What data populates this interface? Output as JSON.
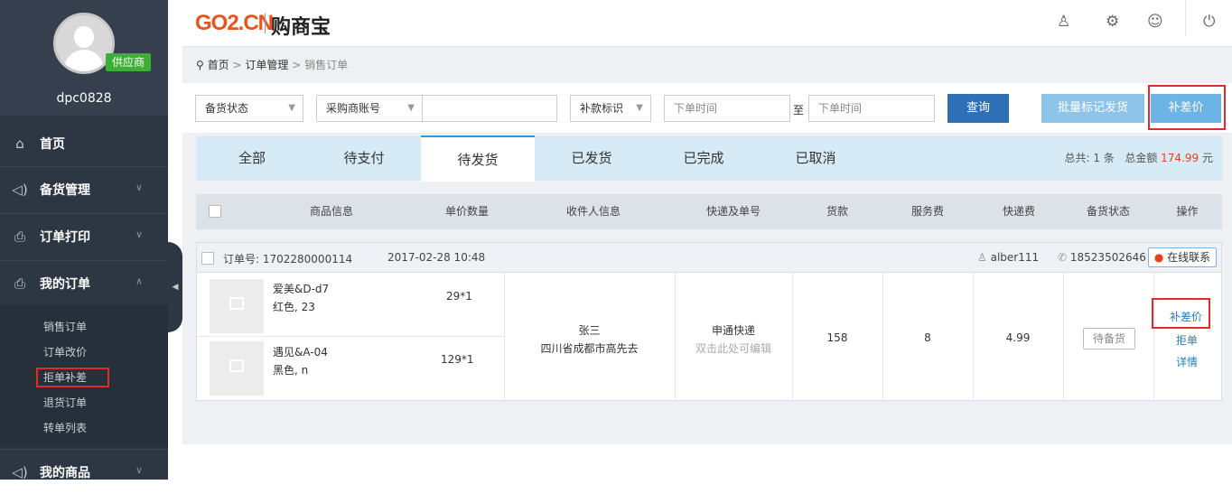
{
  "sidebar": {
    "role_badge": "供应商",
    "username": "dpc0828",
    "nav": [
      {
        "label": "首页",
        "icon": "home-icon"
      },
      {
        "label": "备货管理",
        "icon": "speaker-icon"
      },
      {
        "label": "订单打印",
        "icon": "printer-icon"
      },
      {
        "label": "我的订单",
        "icon": "printer-icon"
      },
      {
        "label": "我的商品",
        "icon": "speaker-icon"
      }
    ],
    "submenu": [
      "销售订单",
      "订单改价",
      "拒单补差",
      "退货订单",
      "转单列表"
    ]
  },
  "header": {
    "logo_text": "GO2.CN",
    "logo_cn": "购商宝"
  },
  "breadcrumb": {
    "home": "首页",
    "sep": ">",
    "level1": "订单管理",
    "level2": "销售订单"
  },
  "filters": {
    "stock_status": "备货状态",
    "buyer_account": "采购商账号",
    "buyer_account_value": "",
    "supplement_flag": "补款标识",
    "date_from_placeholder": "下单时间",
    "to_label": "至",
    "date_to_placeholder": "下单时间",
    "query_button": "查询",
    "batch_ship_button": "批量标记发货",
    "supplement_button": "补差价"
  },
  "tabs": [
    "全部",
    "待支付",
    "待发货",
    "已发货",
    "已完成",
    "已取消"
  ],
  "summary": {
    "prefix": "总共: 1 条",
    "amount_label": "总金额",
    "amount": "174.99",
    "unit": "元"
  },
  "columns": [
    "商品信息",
    "单价数量",
    "收件人信息",
    "快递及单号",
    "货款",
    "服务费",
    "快递费",
    "备货状态",
    "操作"
  ],
  "order": {
    "order_no": "订单号: 1702280000114",
    "time": "2017-02-28 10:48",
    "buyer": "alber111",
    "phone": "18523502646",
    "chat_button": "在线联系",
    "items": [
      {
        "name": "爱美&D-d7",
        "spec": "红色, 23",
        "qty": "29*1"
      },
      {
        "name": "遇见&A-04",
        "spec": "黑色, n",
        "qty": "129*1"
      }
    ],
    "recipient_name": "张三",
    "recipient_addr": "四川省成都市高先去",
    "express": "申通快递",
    "express_hint": "双击此处可编辑",
    "goods_amount": "158",
    "service_fee": "8",
    "shipping_fee": "4.99",
    "stock_status_button": "待备货",
    "actions": [
      "补差价",
      "拒单",
      "详情"
    ]
  },
  "colors": {
    "sidebar": "#2d3643",
    "accent_blue": "#2e6fb6",
    "light_blue": "#6db4e6",
    "highlight_red": "#e02b2b",
    "badge_green": "#3cb034",
    "amount_red": "#e8401c"
  }
}
